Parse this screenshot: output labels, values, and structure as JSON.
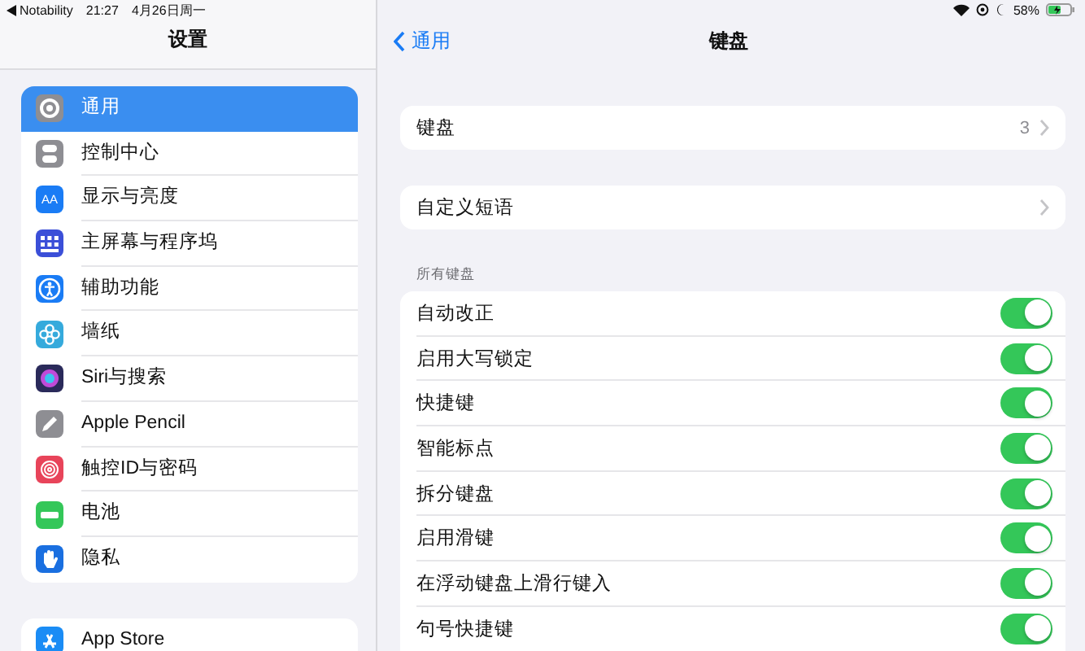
{
  "status_bar": {
    "back_app": "Notability",
    "time": "21:27",
    "date": "4月26日周一",
    "battery_percent": "58%"
  },
  "sidebar": {
    "title": "设置",
    "groups": [
      [
        {
          "label": "通用",
          "kind": "gear",
          "color": "#8e8e93",
          "selected": true
        },
        {
          "label": "控制中心",
          "kind": "switches",
          "color": "#8e8e93",
          "selected": false
        },
        {
          "label": "显示与亮度",
          "kind": "lettered",
          "icon_text": "AA",
          "color": "#1a7cf5",
          "selected": false
        },
        {
          "label": "主屏幕与程序坞",
          "kind": "grid",
          "color": "#3b4fd8",
          "selected": false
        },
        {
          "label": "辅助功能",
          "kind": "person",
          "color": "#1a7cf5",
          "selected": false
        },
        {
          "label": "墙纸",
          "kind": "flower",
          "color": "#35aadc",
          "selected": false
        },
        {
          "label": "Siri与搜索",
          "kind": "orb",
          "color": "#2a2a5a",
          "selected": false
        },
        {
          "label": "Apple Pencil",
          "kind": "pencil",
          "color": "#8e8e93",
          "selected": false
        },
        {
          "label": "触控ID与密码",
          "kind": "fingerprint",
          "color": "#e8445a",
          "selected": false
        },
        {
          "label": "电池",
          "kind": "battery",
          "color": "#34c759",
          "selected": false
        },
        {
          "label": "隐私",
          "kind": "hand",
          "color": "#1a6fe0",
          "selected": false
        }
      ],
      [
        {
          "label": "App Store",
          "kind": "store",
          "color": "#1a8cf5",
          "selected": false
        }
      ]
    ]
  },
  "detail": {
    "back_label": "通用",
    "title": "键盘",
    "links": [
      {
        "label": "键盘",
        "value": "3"
      },
      {
        "label": "自定义短语"
      }
    ],
    "section_header": "所有键盘",
    "toggles": [
      {
        "label": "自动改正",
        "on": true
      },
      {
        "label": "启用大写锁定",
        "on": true
      },
      {
        "label": "快捷键",
        "on": true
      },
      {
        "label": "智能标点",
        "on": true
      },
      {
        "label": "拆分键盘",
        "on": true
      },
      {
        "label": "启用滑键",
        "on": true
      },
      {
        "label": "在浮动键盘上滑行键入",
        "on": true
      },
      {
        "label": "句号快捷键",
        "on": true
      }
    ]
  }
}
